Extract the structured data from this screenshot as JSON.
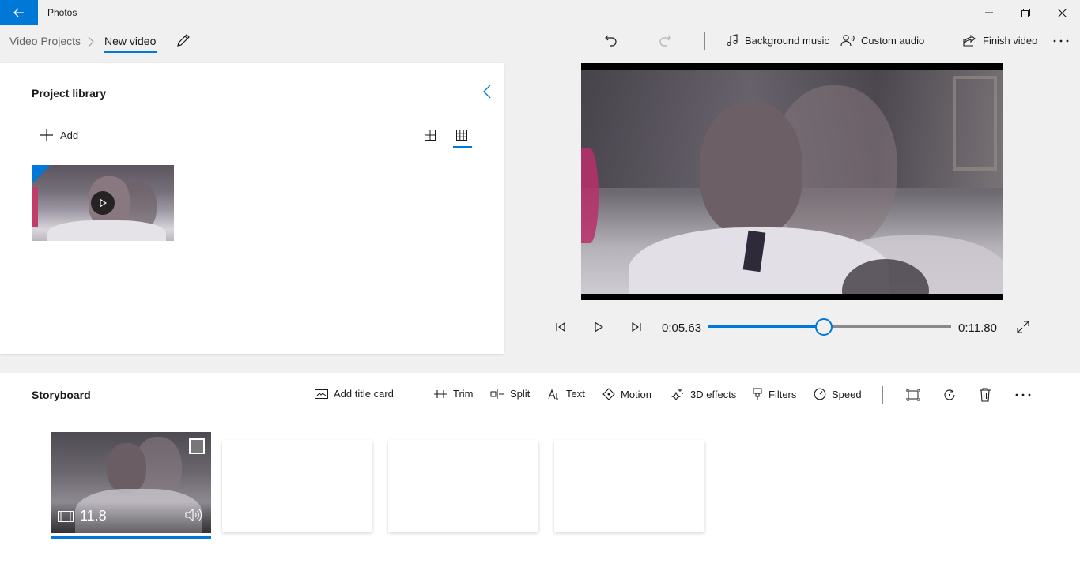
{
  "window": {
    "app_title": "Photos"
  },
  "breadcrumb": {
    "parent": "Video Projects",
    "current": "New video"
  },
  "toolbar": {
    "background_music": "Background music",
    "custom_audio": "Custom audio",
    "finish_video": "Finish video"
  },
  "library": {
    "title": "Project library",
    "add_label": "Add",
    "items": [
      {
        "type": "video",
        "state": "in-use"
      }
    ]
  },
  "playback": {
    "current_time": "0:05.63",
    "total_time": "0:11.80",
    "progress": 0.477
  },
  "storyboard": {
    "title": "Storyboard",
    "tools": {
      "add_title_card": "Add title card",
      "trim": "Trim",
      "split": "Split",
      "text": "Text",
      "motion": "Motion",
      "effects_3d": "3D effects",
      "filters": "Filters",
      "speed": "Speed"
    },
    "clips": [
      {
        "duration": "11.8",
        "selected": true
      }
    ],
    "empty_slots": 3
  },
  "colors": {
    "accent": "#0078d7",
    "background": "#f0f0f0",
    "panel": "#ffffff"
  },
  "icons": {
    "back": "back-arrow-icon",
    "minimize": "minimize-icon",
    "maximize": "restore-icon",
    "close": "close-icon",
    "rename": "pencil-icon",
    "undo": "undo-icon",
    "redo": "redo-icon",
    "music": "music-note-icon",
    "audio": "person-audio-icon",
    "share": "share-icon",
    "more": "more-icon"
  }
}
